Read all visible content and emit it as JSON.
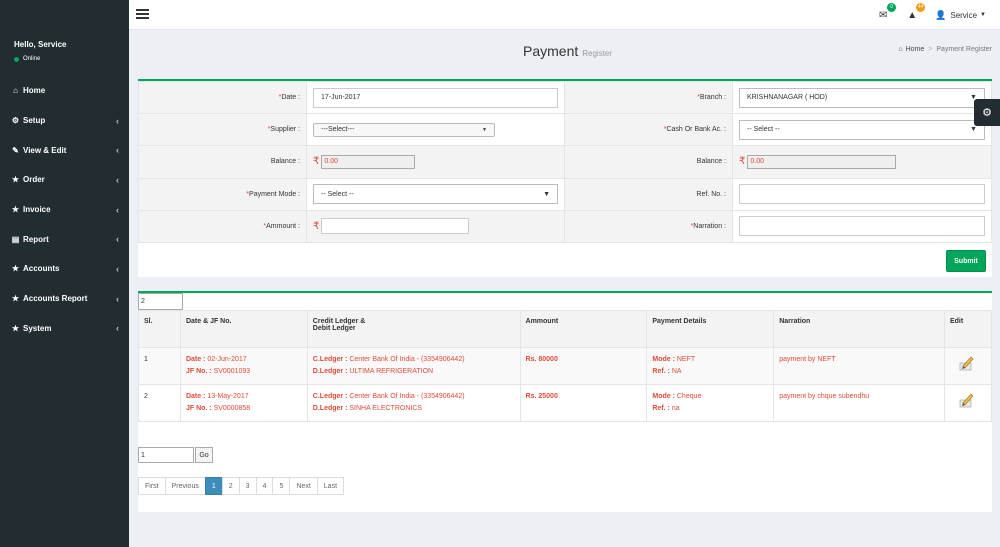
{
  "sidebar": {
    "user_name": "Hello, Service",
    "user_status": "Online",
    "items": [
      {
        "label": "Home",
        "icon": "home-icon",
        "glyph": "⌂",
        "chevron": false
      },
      {
        "label": "Setup",
        "icon": "cogs-icon",
        "glyph": "⚙",
        "chevron": true
      },
      {
        "label": "View & Edit",
        "icon": "edit-icon",
        "glyph": "✎",
        "chevron": true
      },
      {
        "label": "Order",
        "icon": "star-icon",
        "glyph": "★",
        "chevron": true
      },
      {
        "label": "Invoice",
        "icon": "star-icon",
        "glyph": "★",
        "chevron": true
      },
      {
        "label": "Report",
        "icon": "file-icon",
        "glyph": "▤",
        "chevron": true
      },
      {
        "label": "Accounts",
        "icon": "star-icon",
        "glyph": "★",
        "chevron": true
      },
      {
        "label": "Accounts Report",
        "icon": "star-icon",
        "glyph": "★",
        "chevron": true
      },
      {
        "label": "System",
        "icon": "star-icon",
        "glyph": "★",
        "chevron": true
      }
    ]
  },
  "topbar": {
    "mail_badge": "0",
    "alert_badge": "44",
    "user_label": "Service"
  },
  "header": {
    "title": "Payment",
    "subtitle": "Register",
    "breadcrumb_home": "Home",
    "breadcrumb_current": "Payment Register"
  },
  "form": {
    "date_label": "Date :",
    "date_value": "17-Jun-2017",
    "branch_label": "Branch :",
    "branch_value": "KRISHNANAGAR ( HOD)",
    "supplier_label": "Supplier :",
    "supplier_value": "---Select---",
    "cash_bank_label": "Cash Or Bank Ac. :",
    "cash_bank_value": "-- Select --",
    "balance_label": "Balance :",
    "balance_left": "0.00",
    "balance_right": "0.00",
    "payment_mode_label": "Payment Mode :",
    "payment_mode_value": "-- Select --",
    "ref_label": "Ref. No. :",
    "amount_label": "Ammount :",
    "narration_label": "Narration :",
    "rupee": "₹",
    "submit_label": "Submit"
  },
  "table": {
    "page_size": "2",
    "headers": {
      "sl": "Sl.",
      "date": "Date & JF No.",
      "ledger_1": "Credit Ledger &",
      "ledger_2": "Debit Ledger",
      "amount": "Ammount",
      "payment": "Payment Details",
      "narration": "Narration",
      "edit": "Edit"
    },
    "keys": {
      "date": "Date : ",
      "jf": "JF No. : ",
      "cledger": "C.Ledger : ",
      "dledger": "D.Ledger : ",
      "mode": "Mode : ",
      "ref": "Ref. : "
    },
    "rows": [
      {
        "sl": "1",
        "date": "02-Jun-2017",
        "jf": "SV0001093",
        "cledger": "Center Bank Of India - (3354906442)",
        "dledger": "ULTIMA REFRIGERATION",
        "amount": "Rs. 80000",
        "mode": "NEFT",
        "ref": "NA",
        "narration": "payment by NEFT"
      },
      {
        "sl": "2",
        "date": "13-May-2017",
        "jf": "SV0000858",
        "cledger": "Center Bank Of India - (3354906442)",
        "dledger": "SINHA ELECTRONICS",
        "amount": "Rs. 25000",
        "mode": "Cheque",
        "ref": "na",
        "narration": "payment by chque subendhu"
      }
    ]
  },
  "pagination": {
    "goto_value": "1",
    "go_label": "Go",
    "first": "First",
    "previous": "Previous",
    "pages": [
      "1",
      "2",
      "3",
      "4",
      "5"
    ],
    "next": "Next",
    "last": "Last"
  }
}
